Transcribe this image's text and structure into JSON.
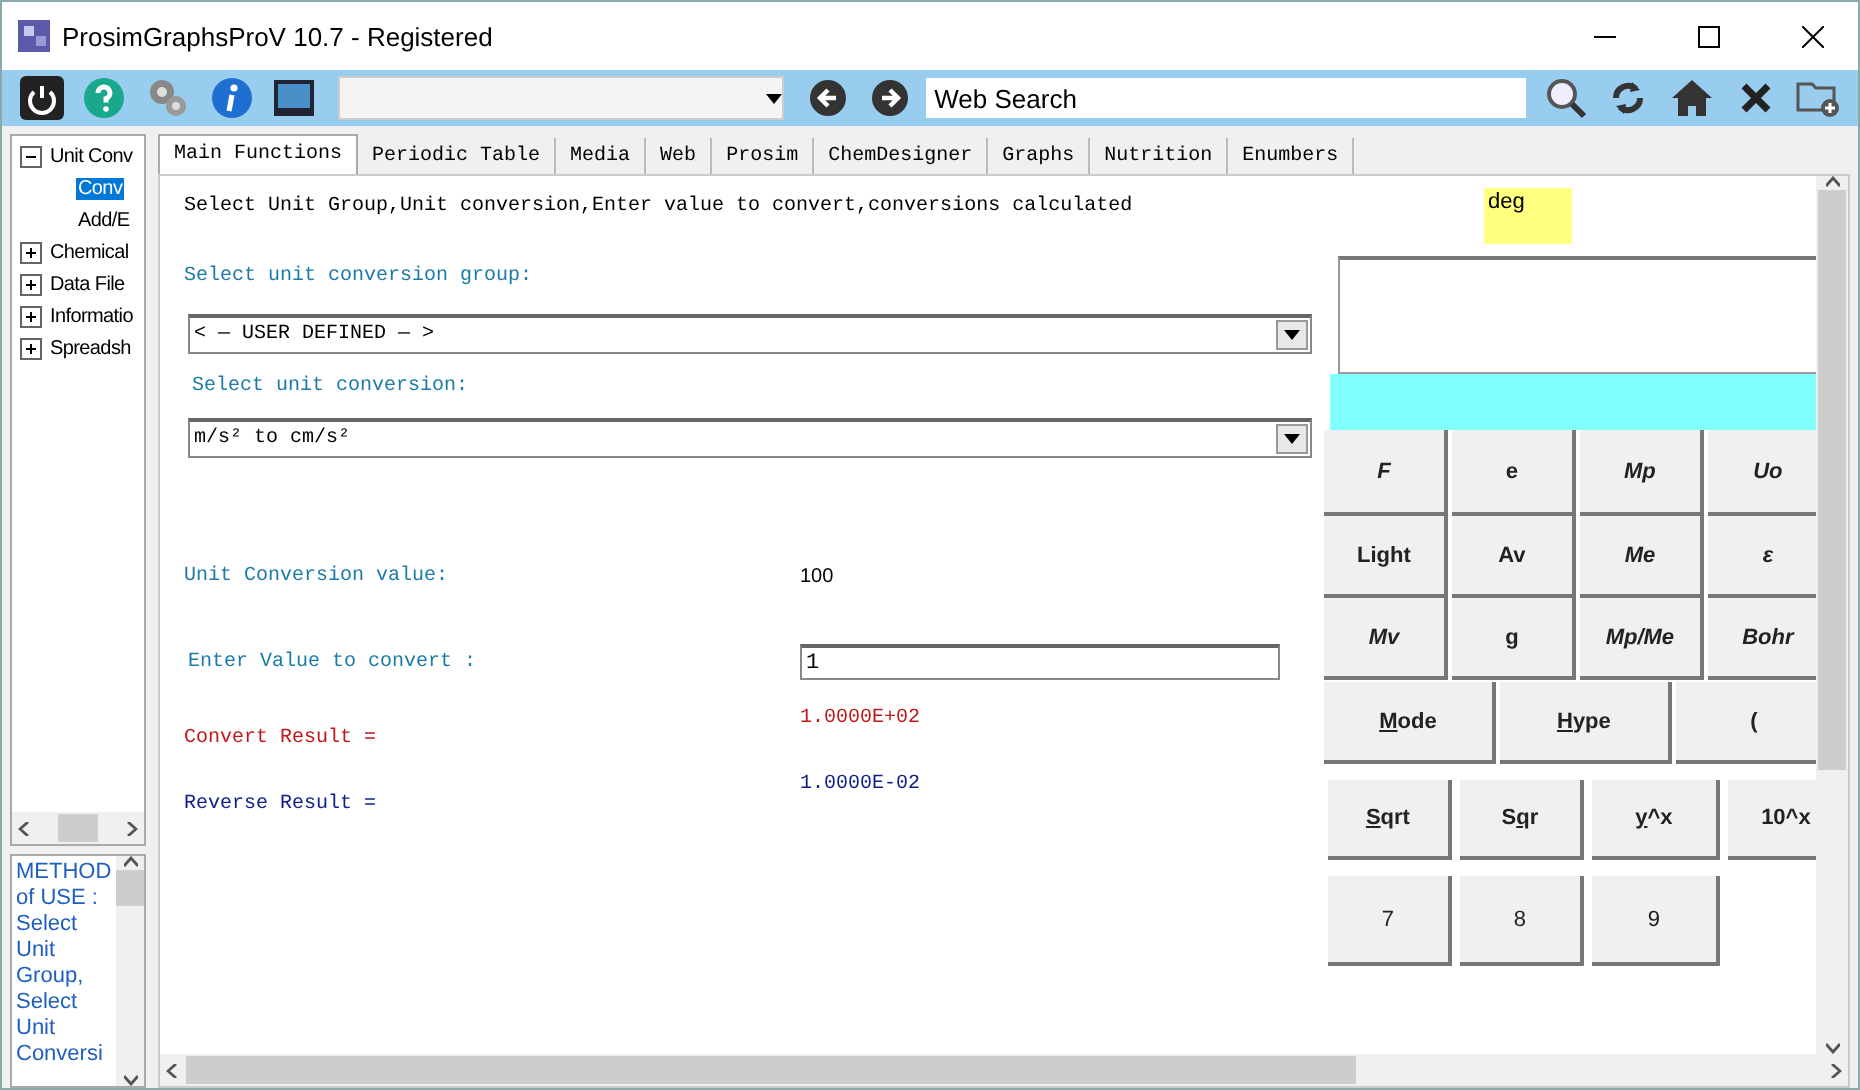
{
  "window": {
    "title": "ProsimGraphsProV 10.7 - Registered"
  },
  "toolbar": {
    "search": {
      "value": "Web Search"
    }
  },
  "tree": [
    {
      "label": "Unit Conv",
      "expanded": true,
      "selected": false,
      "children": [
        {
          "label": "Conv",
          "selected": true
        },
        {
          "label": "Add/E",
          "selected": false
        }
      ]
    },
    {
      "label": "Chemical",
      "expanded": false,
      "selected": false
    },
    {
      "label": "Data File",
      "expanded": false,
      "selected": false
    },
    {
      "label": "Informatio",
      "expanded": false,
      "selected": false
    },
    {
      "label": "Spreadsh",
      "expanded": false,
      "selected": false
    }
  ],
  "method_text": "METHOD of USE : Select Unit Group, Select Unit Conversi",
  "tabs": [
    {
      "label": "Main Functions",
      "selected": true
    },
    {
      "label": "Periodic Table",
      "selected": false
    },
    {
      "label": "Media",
      "selected": false
    },
    {
      "label": "Web",
      "selected": false
    },
    {
      "label": "Prosim",
      "selected": false
    },
    {
      "label": "ChemDesigner",
      "selected": false
    },
    {
      "label": "Graphs",
      "selected": false
    },
    {
      "label": "Nutrition",
      "selected": false
    },
    {
      "label": "Enumbers",
      "selected": false
    }
  ],
  "form": {
    "instructions": "Select Unit Group,Unit conversion,Enter value to convert,conversions calculated",
    "group_label": "Select unit conversion group:",
    "group_value": "< — USER DEFINED — >",
    "conversion_label": "Select unit conversion:",
    "conversion_value": "m/s² to cm/s²",
    "value_label": "Unit Conversion value:",
    "value": "100",
    "input_label": "Enter Value to convert :",
    "input_value": "1",
    "convert_label": "Convert Result =",
    "convert_result": "1.0000E+02",
    "reverse_label": "Reverse Result =",
    "reverse_result": "1.0000E-02"
  },
  "calculator": {
    "mode": "deg",
    "rows": [
      [
        {
          "parts": [
            "F"
          ],
          "italic": true
        },
        {
          "parts": [
            "e"
          ],
          "italic": false
        },
        {
          "parts": [
            "Mp"
          ],
          "italic": true
        },
        {
          "parts": [
            "Uo"
          ],
          "italic": true
        }
      ],
      [
        {
          "parts": [
            "Light"
          ],
          "italic": false
        },
        {
          "parts": [
            "Av"
          ],
          "italic": false
        },
        {
          "parts": [
            "Me"
          ],
          "italic": true
        },
        {
          "parts": [
            "ε"
          ],
          "italic": true
        }
      ],
      [
        {
          "parts": [
            "Mv"
          ],
          "italic": true
        },
        {
          "parts": [
            "g"
          ],
          "italic": false
        },
        {
          "parts": [
            "Mp/Me"
          ],
          "italic": true
        },
        {
          "parts": [
            "Bohr"
          ],
          "italic": true
        }
      ],
      [
        {
          "parts": [
            "M",
            "ode"
          ],
          "accel_first": true,
          "italic": false
        },
        {
          "parts": [
            "H",
            "ype"
          ],
          "accel_first": true,
          "italic": false
        },
        {
          "parts": [
            "("
          ],
          "italic": false
        }
      ],
      [
        {
          "parts": [
            "S",
            "qrt"
          ],
          "accel_first": true,
          "italic": false
        },
        {
          "parts": [
            "S",
            "q",
            "r"
          ],
          "italic": false
        },
        {
          "parts": [
            "y",
            "^x"
          ],
          "accel_first": true,
          "italic": false
        },
        {
          "parts": [
            "10^x"
          ],
          "italic": false
        }
      ],
      [
        {
          "parts": [
            "7"
          ],
          "italic": false
        },
        {
          "parts": [
            "8"
          ],
          "italic": false
        },
        {
          "parts": [
            "9"
          ],
          "italic": false
        }
      ]
    ]
  }
}
